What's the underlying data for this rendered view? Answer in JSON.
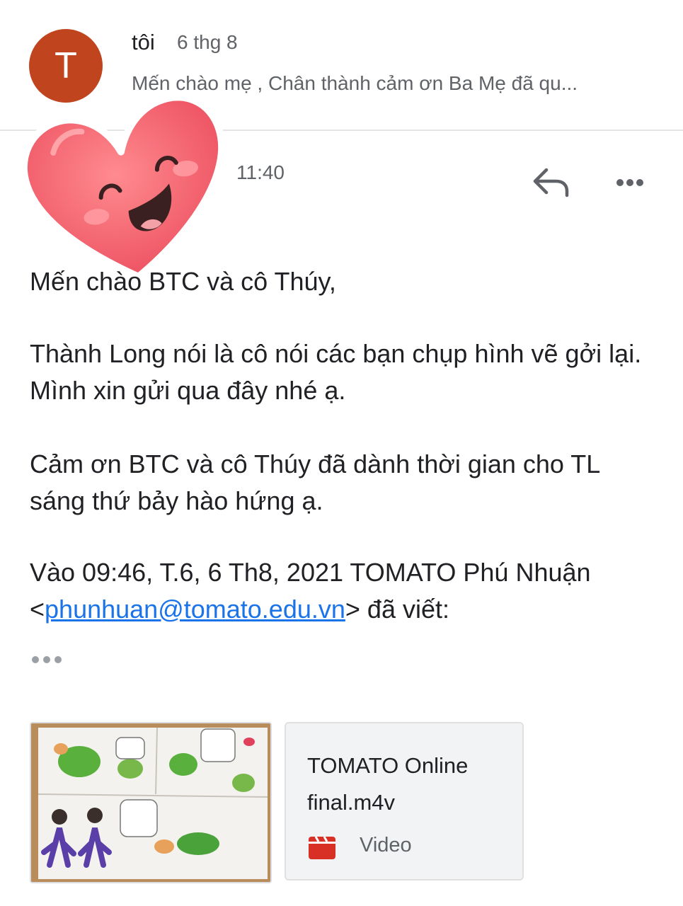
{
  "thread": {
    "previous_message": {
      "avatar_letter": "T",
      "avatar_color": "#c0451f",
      "sender": "tôi",
      "date": "6 thg 8",
      "snippet": "Mến chào mẹ , Chân thành cảm ơn Ba Mẹ đã qu..."
    },
    "open_message": {
      "time": "11:40",
      "body": {
        "greeting": "Mến chào BTC và cô Thúy,",
        "paragraph_1": "Thành Long nói là cô nói các bạn chụp hình vẽ gởi lại. Mình xin gửi qua đây nhé ạ.",
        "paragraph_2": "Cảm ơn BTC và cô Thúy đã dành thời gian cho TL sáng thứ bảy hào hứng ạ.",
        "quote_intro": "Vào 09:46, T.6, 6 Th8, 2021 TOMATO Phú Nhuận <",
        "quote_email": "phunhuan@tomato.edu.vn",
        "quote_outro": "> đã viết:"
      },
      "attachments": [
        {
          "kind": "image",
          "description": "children's drawing"
        },
        {
          "kind": "video",
          "name": "TOMATO Online final.m4v",
          "type_label": "Video",
          "icon_color": "#d93025"
        }
      ]
    }
  },
  "icons": {
    "reply": "reply-icon",
    "more": "more-horizontal-icon",
    "show_trimmed": "ellipsis-icon",
    "video": "video-file-icon",
    "sticker": "heart-sticker"
  },
  "colors": {
    "link": "#1a73e8",
    "secondary_text": "#5f6368",
    "heart": "#f0606c"
  }
}
